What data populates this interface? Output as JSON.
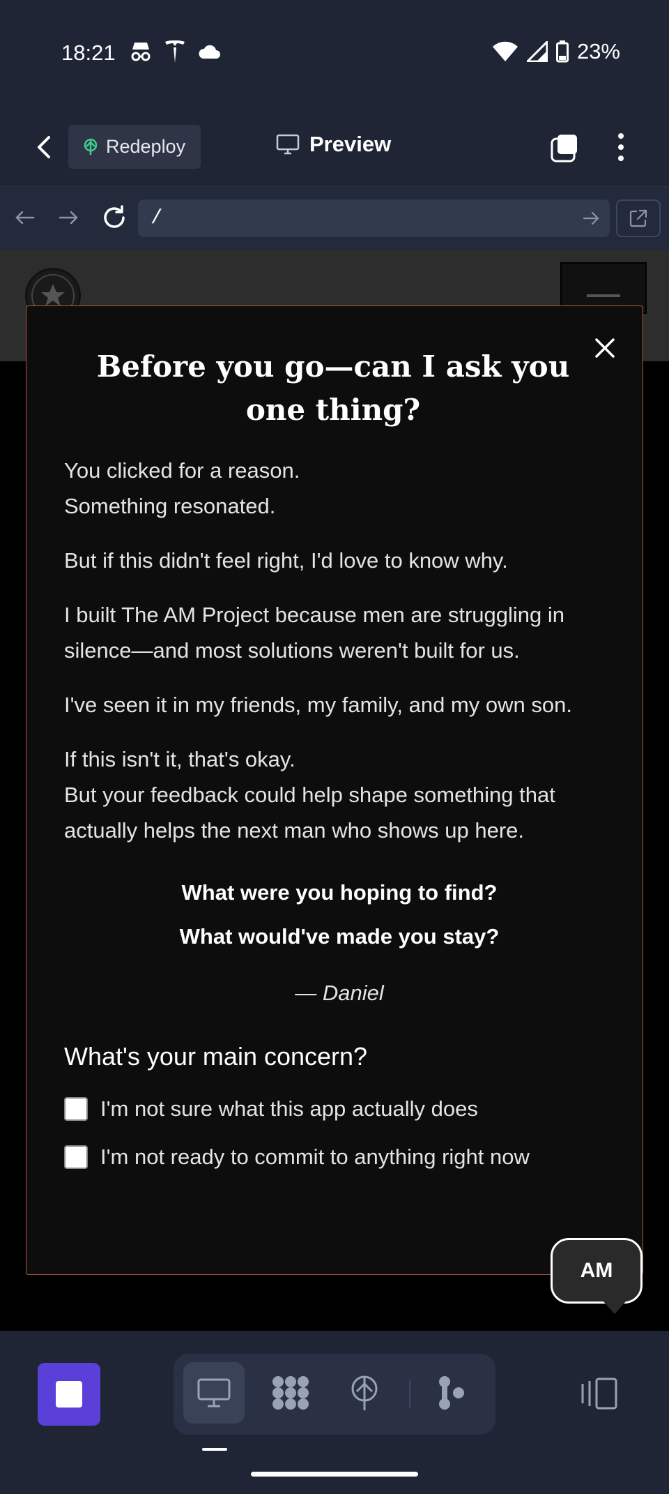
{
  "status_bar": {
    "time": "18:21",
    "battery": "23%",
    "left_icons": [
      "incognito-icon",
      "tesla-icon",
      "cloud-icon"
    ],
    "right_icons": [
      "wifi-icon",
      "signal-icon",
      "battery-icon"
    ]
  },
  "toolbar": {
    "redeploy_label": "Redeploy",
    "preview_label": "Preview"
  },
  "url_bar": {
    "value": "/"
  },
  "modal": {
    "title": "Before you go—can I ask you one thing?",
    "paragraphs": [
      [
        "You clicked for a reason.",
        "Something resonated."
      ],
      [
        "But if this didn't feel right, I'd love to know why."
      ],
      [
        "I built The AM Project because men are struggling in silence—and most solutions weren't built for us."
      ],
      [
        "I've seen it in my friends, my family, and my own son."
      ],
      [
        "If this isn't it, that's okay.",
        "But your feedback could help shape something that actually helps the next man who shows up here."
      ]
    ],
    "question_1": "What were you hoping to find?",
    "question_2": "What would've made you stay?",
    "signature": "— Daniel",
    "concern_title": "What's your main concern?",
    "options": [
      "I'm not sure what this app actually does",
      "I'm not ready to commit to anything right now"
    ]
  },
  "chat_bubble": {
    "label": "AM"
  },
  "colors": {
    "accent_purple": "#5b3fd9",
    "modal_border": "#b45a3c",
    "redeploy_icon": "#3ecf8e",
    "app_bg": "#1f2535"
  }
}
